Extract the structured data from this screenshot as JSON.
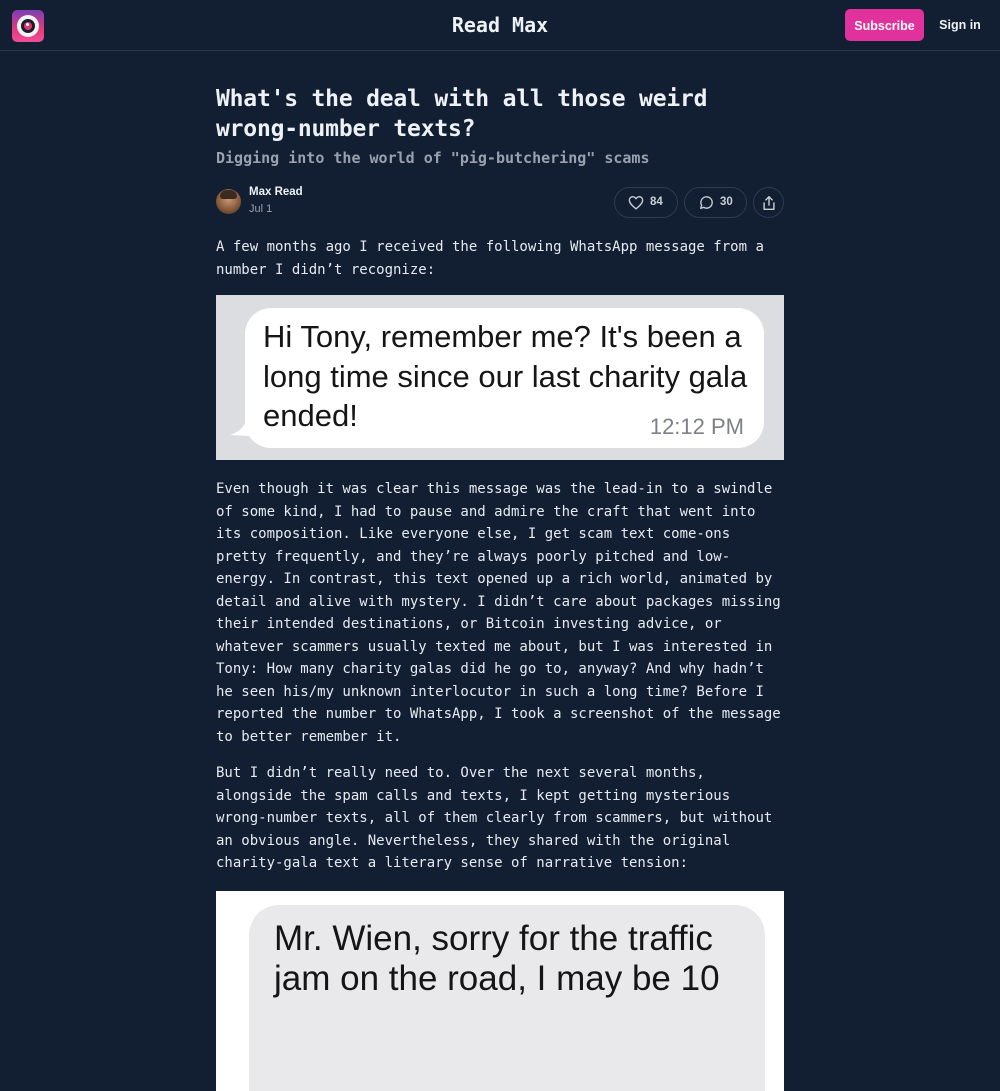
{
  "header": {
    "site_title": "Read Max",
    "subscribe_label": "Subscribe",
    "signin_label": "Sign in"
  },
  "article": {
    "title": "What's the deal with all those weird wrong-number texts?",
    "subtitle": "Digging into the world of \"pig-butchering\" scams",
    "author": "Max Read",
    "date": "Jul 1",
    "likes": "84",
    "comments": "30",
    "intro": "A few months ago I received the following WhatsApp message from a number I didn’t recognize:",
    "screenshot1": {
      "message": "Hi Tony, remember me? It's been a long time since our last charity gala ended!",
      "time": "12:12 PM"
    },
    "paragraph2": "Even though it was clear this message was the lead-in to a swindle of some kind, I had to pause and admire the craft that went into its composition. Like everyone else, I get scam text come-ons pretty frequently, and they’re always poorly pitched and low-energy. In contrast, this text opened up a rich world, animated by detail and alive with mystery. I didn’t care about packages missing their intended destinations, or Bitcoin investing advice, or whatever scammers usually texted me about, but I was interested in Tony: How many charity galas did he go to, anyway? And why hadn’t he seen his/my unknown interlocutor in such a long time? Before I reported the number to WhatsApp, I took a screenshot of the message to better remember it.",
    "paragraph3": "But I didn’t really need to. Over the next several months, alongside the spam calls and texts, I kept getting mysterious wrong-number texts, all of them clearly from scammers, but without an obvious angle. Nevertheless, they shared with the original charity-gala text a literary sense of narrative tension:",
    "screenshot2": {
      "message": "Mr. Wien, sorry for the traffic jam on the road, I may be 10"
    }
  },
  "icons": {
    "logo": "camera-lens-logo",
    "like": "heart-icon",
    "comment": "comment-bubble-icon",
    "share": "share-icon"
  },
  "colors": {
    "background": "#121f33",
    "accent": "#e0319d",
    "text": "#e6eaf0",
    "muted": "#98a1ae"
  }
}
